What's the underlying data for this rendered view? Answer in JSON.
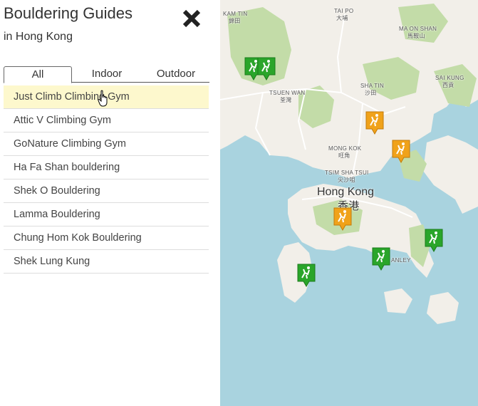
{
  "sidebar": {
    "title": "Bouldering Guides",
    "subtitle": "in Hong Kong",
    "close_icon": "close-x-icon",
    "tabs": [
      {
        "label": "All",
        "active": true
      },
      {
        "label": "Indoor",
        "active": false
      },
      {
        "label": "Outdoor",
        "active": false
      }
    ],
    "items": [
      {
        "label": "Just Climb Climbing Gym",
        "highlighted": true
      },
      {
        "label": "Attic V Climbing Gym"
      },
      {
        "label": "GoNature Climbing Gym"
      },
      {
        "label": "Ha Fa Shan bouldering"
      },
      {
        "label": "Shek O Bouldering"
      },
      {
        "label": "Lamma Bouldering"
      },
      {
        "label": "Chung Hom Kok Bouldering"
      },
      {
        "label": "Shek Lung Kung"
      }
    ]
  },
  "map": {
    "labels": {
      "kam_tin": "KAM TIN",
      "kam_tin_cn": "錦田",
      "tai_po": "TAI PO",
      "tai_po_cn": "大埔",
      "ma_on_shan": "MA ON SHAN",
      "ma_on_shan_cn": "馬鞍山",
      "sai_kung": "SAI KUNG",
      "sai_kung_cn": "西貢",
      "tsuen_wan": "TSUEN WAN",
      "tsuen_wan_cn": "荃灣",
      "sha_tin": "SHA TIN",
      "sha_tin_cn": "沙田",
      "mong_kok": "MONG KOK",
      "mong_kok_cn": "旺角",
      "tsim_sha_tsui": "TSIM SHA TSUI",
      "tsim_sha_tsui_cn": "尖沙咀",
      "hong_kong": "Hong Kong",
      "hong_kong_cn": "香港",
      "stanley": "ANLEY"
    },
    "colors": {
      "water": "#a9d3df",
      "land": "#f2efe9",
      "park": "#c3dca8",
      "indoor_marker": "#f0a21a",
      "outdoor_marker": "#2aa52a"
    }
  }
}
